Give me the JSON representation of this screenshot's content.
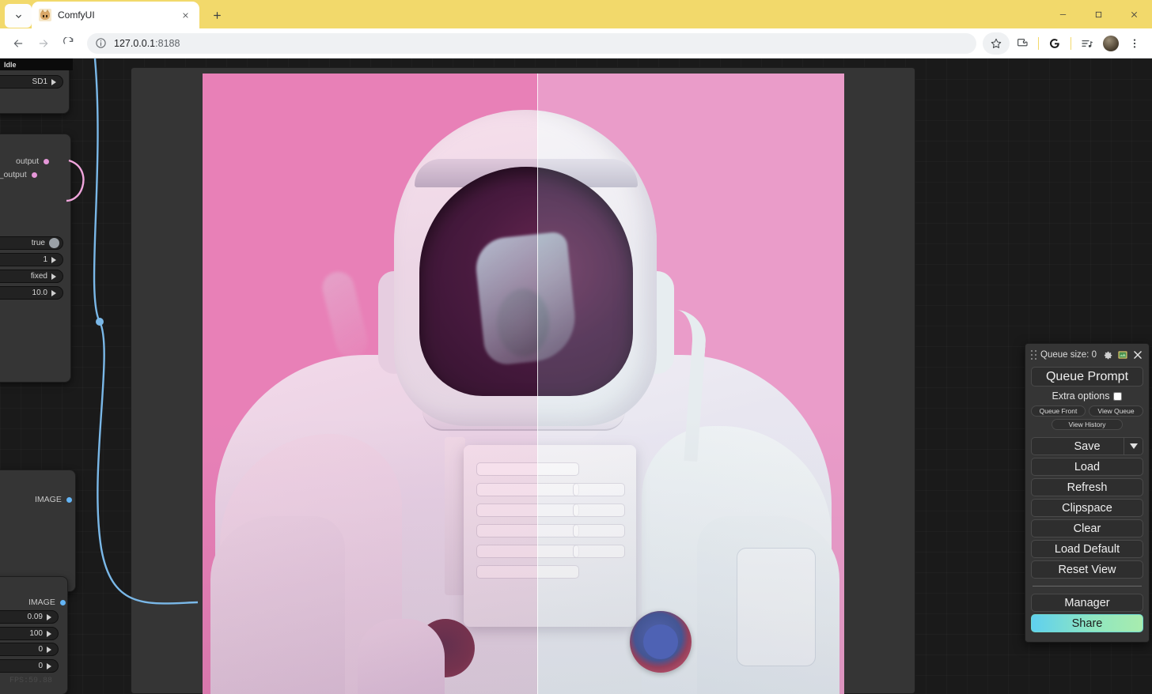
{
  "browser": {
    "tab": {
      "title": "ComfyUI",
      "favicon": "comfyui-favicon"
    },
    "url_host": "127.0.0.1",
    "url_port": ":8188",
    "toolbar_icons": [
      "star-icon",
      "extensions-icon",
      "google-icon",
      "playlist-icon",
      "avatar",
      "more-menu-icon"
    ],
    "window_controls": [
      "minimize",
      "maximize",
      "close"
    ]
  },
  "comfy": {
    "status": "Idle",
    "fps": "FPS:59.88",
    "nodes": {
      "top": {
        "widget": "SD1"
      },
      "sampler": {
        "outputs": [
          "output",
          "denoised_output"
        ],
        "widgets": [
          "true",
          "1",
          "fixed",
          "10.0"
        ]
      },
      "image_a": {
        "output": "IMAGE"
      },
      "image_b": {
        "output": "IMAGE",
        "widgets": [
          "0.09",
          "100",
          "0",
          "0"
        ]
      }
    }
  },
  "menu": {
    "queue_size_label": "Queue size: 0",
    "header_icons": [
      "gear-icon",
      "chart-icon",
      "close-icon"
    ],
    "queue_prompt": "Queue Prompt",
    "extra_options": "Extra options",
    "extra_options_checked": false,
    "queue_front": "Queue Front",
    "view_queue": "View Queue",
    "view_history": "View History",
    "save": "Save",
    "load": "Load",
    "refresh": "Refresh",
    "clipspace": "Clipspace",
    "clear": "Clear",
    "load_default": "Load Default",
    "reset_view": "Reset View",
    "manager": "Manager",
    "share": "Share",
    "share_gradient_start": "#5fd0ef",
    "share_gradient_end": "#a8ecae"
  },
  "image": {
    "subject": "astronaut-in-white-spacesuit",
    "background_color": "#e88cc0",
    "comparison_slider_x_pct": 52
  }
}
